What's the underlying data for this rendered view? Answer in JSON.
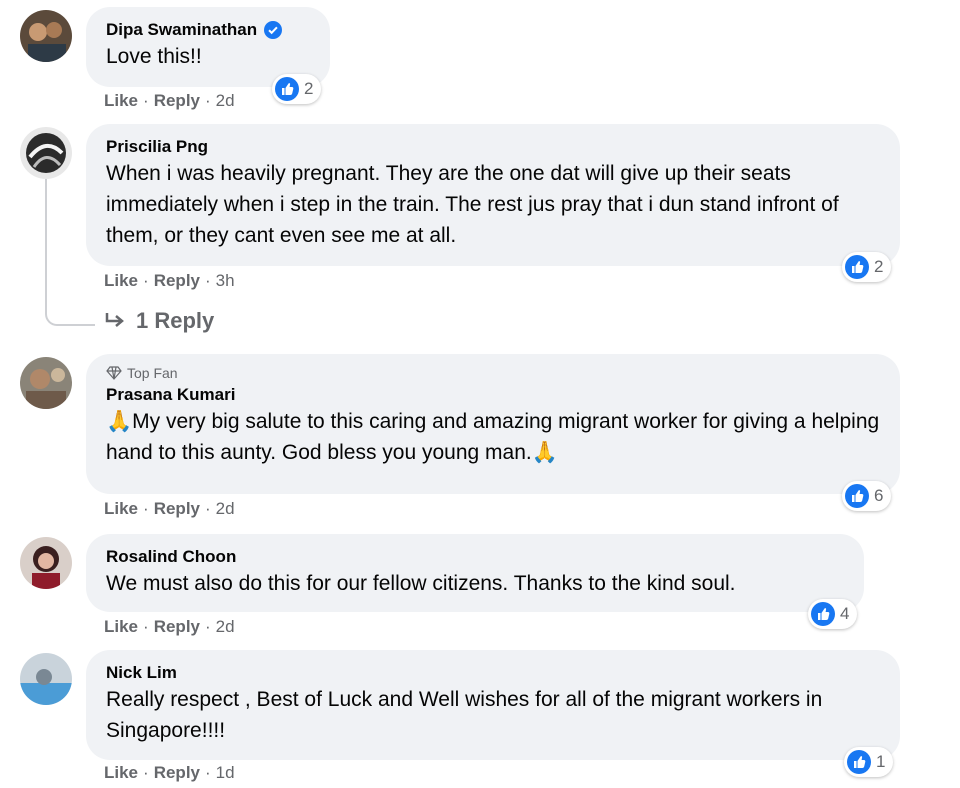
{
  "comments": [
    {
      "name": "Dipa Swaminathan",
      "verified": true,
      "text": "Love this!!",
      "like": "Like",
      "reply": "Reply",
      "time": "2d",
      "reactions": "2"
    },
    {
      "name": "Priscilia Png",
      "verified": false,
      "text": "When i was heavily pregnant. They are the one dat will give up their seats immediately when i step in the train. The rest jus pray that i dun stand infront of them, or they cant even see me at all.",
      "like": "Like",
      "reply": "Reply",
      "time": "3h",
      "reactions": "2",
      "replies_label": "1 Reply"
    },
    {
      "name": "Prasana Kumari",
      "badge": "Top Fan",
      "text": "🙏My very big salute to this caring and amazing migrant worker for giving a helping hand to this aunty. God bless you young man.🙏",
      "like": "Like",
      "reply": "Reply",
      "time": "2d",
      "reactions": "6"
    },
    {
      "name": "Rosalind Choon",
      "text": "We must also do this for our fellow citizens. Thanks to the kind soul.",
      "like": "Like",
      "reply": "Reply",
      "time": "2d",
      "reactions": "4"
    },
    {
      "name": "Nick Lim",
      "text": "Really respect , Best of Luck and Well wishes for all of the migrant workers in Singapore!!!!",
      "like": "Like",
      "reply": "Reply",
      "time": "1d",
      "reactions": "1"
    }
  ],
  "separator": "·",
  "colors": {
    "bubble": "#f0f2f5",
    "meta": "#65676b",
    "like_blue": "#1877f2"
  },
  "icons": {
    "verified": "verified-badge-icon",
    "like": "like-reaction-icon",
    "reply_arrow": "reply-arrow-icon",
    "diamond": "diamond-icon"
  }
}
